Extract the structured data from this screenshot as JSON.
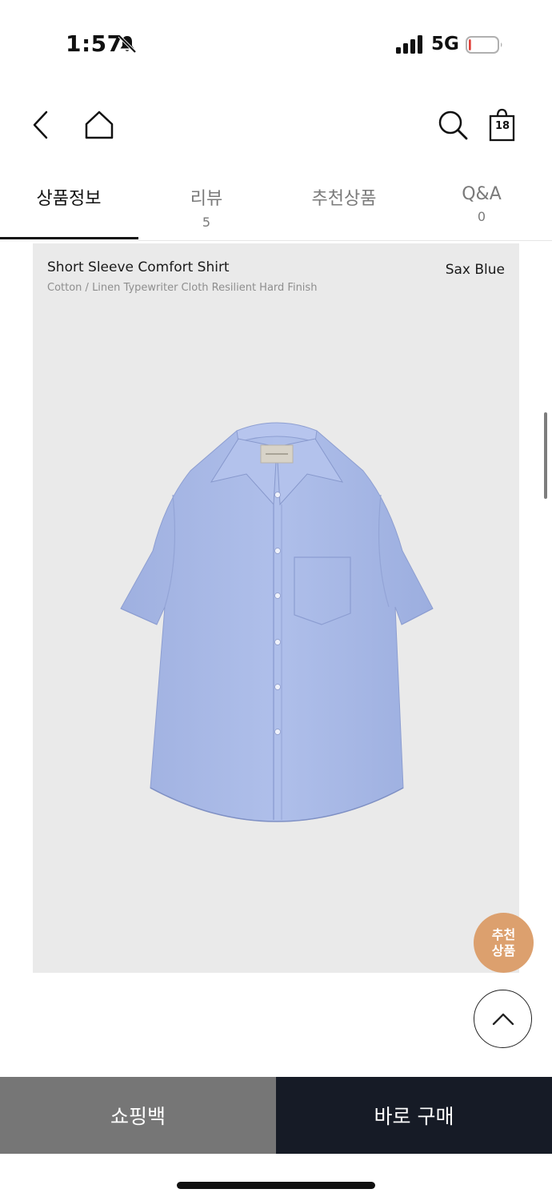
{
  "status_bar": {
    "time": "1:57",
    "network": "5G",
    "battery_level": 0.08,
    "battery_color": "#e0413a"
  },
  "nav": {
    "icons": [
      "back-icon",
      "home-icon",
      "search-icon",
      "shopping-bag-icon"
    ],
    "cart_count": "18"
  },
  "tabs": [
    {
      "label": "상품정보",
      "count": "",
      "active": true
    },
    {
      "label": "리뷰",
      "count": "5",
      "active": false
    },
    {
      "label": "추천상품",
      "count": "",
      "active": false
    },
    {
      "label": "Q&A",
      "count": "0",
      "active": false
    }
  ],
  "product": {
    "name": "Short Sleeve Comfort Shirt",
    "fabric": "Cotton / Linen Typewriter Cloth Resilient Hard Finish",
    "color": "Sax Blue",
    "image": "light-blue-short-sleeve-shirt",
    "shirt_color": "#a9b9e6"
  },
  "floating": {
    "recommend_line1": "추천",
    "recommend_line2": "상품",
    "recommend_color": "#dca06e",
    "scroll_top_icon": "chevron-up-icon"
  },
  "bottom_bar": {
    "shopping_bag_label": "쇼핑백",
    "buy_now_label": "바로 구매",
    "bag_button_color": "#767676",
    "buy_button_color": "#161b26"
  }
}
